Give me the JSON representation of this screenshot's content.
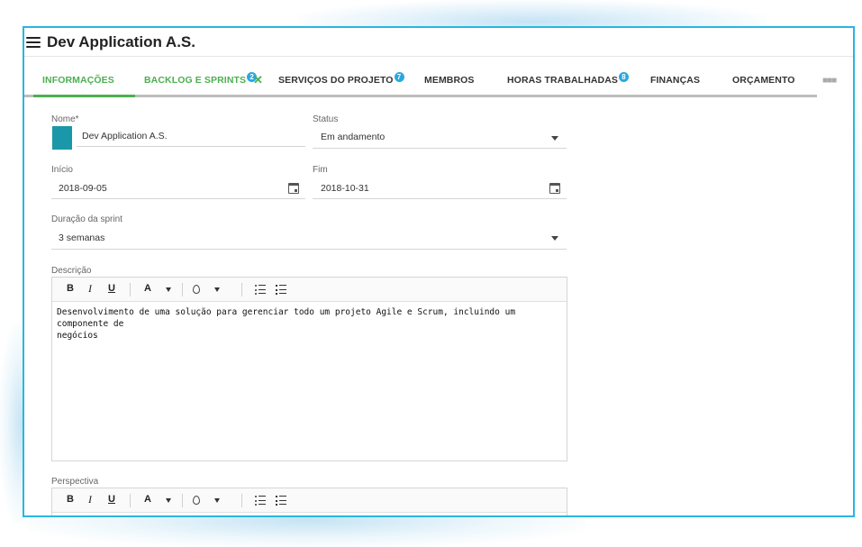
{
  "app": {
    "title": "Dev Application A.S."
  },
  "tabs": [
    {
      "label": "INFORMAÇÕES",
      "badge": ""
    },
    {
      "label": "BACKLOG E SPRINTS",
      "badge": "2"
    },
    {
      "label": "SERVIÇOS DO PROJETO",
      "badge": "7"
    },
    {
      "label": "MEMBROS",
      "badge": ""
    },
    {
      "label": "HORAS TRABALHADAS",
      "badge": "8"
    },
    {
      "label": "FINANÇAS",
      "badge": ""
    },
    {
      "label": "ORÇAMENTO",
      "badge": ""
    }
  ],
  "form": {
    "name_label": "Nome*",
    "name_value": "Dev Application A.S.",
    "status_label": "Status",
    "status_value": "Em andamento",
    "start_label": "Início",
    "start_value": "2018-09-05",
    "end_label": "Fim",
    "end_value": "2018-10-31",
    "sprint_label": "Duração da sprint",
    "sprint_value": "3 semanas",
    "description_label": "Descrição",
    "description_line1": "Desenvolvimento de uma solução para gerenciar todo um projeto Agile e Scrum, incluindo um componente de",
    "description_line2": "negócios",
    "perspective_label": "Perspectiva"
  },
  "toolbar": {
    "bold": "B",
    "italic": "I",
    "underline": "U",
    "font_color": "A"
  },
  "colors": {
    "accent_green": "#4caf50",
    "badge_blue": "#29a8e0",
    "swatch": "#1a97a8",
    "frame": "#29b6e0"
  }
}
